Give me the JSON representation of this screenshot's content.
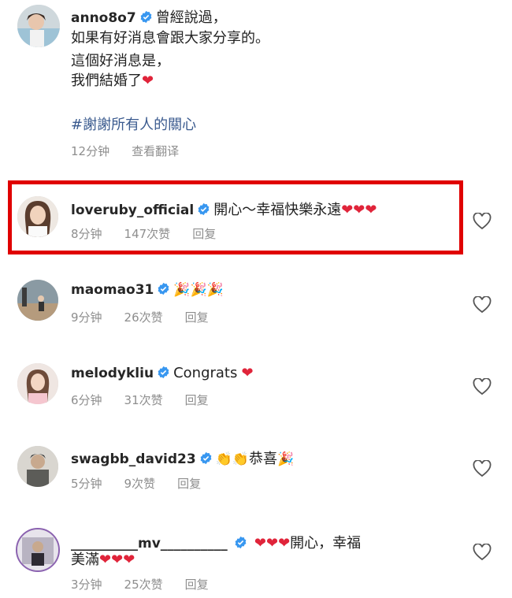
{
  "post": {
    "username": "anno8o7",
    "lines": [
      "曾經說過，",
      "如果有好消息會跟大家分享的。",
      "這個好消息是，",
      "我們結婚了"
    ],
    "hashtag": "#謝謝所有人的關心",
    "time": "12分钟",
    "translate": "查看翻译"
  },
  "comments": [
    {
      "username": "loveruby_official",
      "text": "開心～幸福快樂永遠",
      "emoji": [
        "heart",
        "heart",
        "heart"
      ],
      "time": "8分钟",
      "likes": "147次赞",
      "reply": "回复",
      "highlighted": true
    },
    {
      "username": "maomao31",
      "text": "",
      "emoji": [
        "party",
        "party",
        "party"
      ],
      "time": "9分钟",
      "likes": "26次赞",
      "reply": "回复"
    },
    {
      "username": "melodykliu",
      "text": "Congrats",
      "emoji": [
        "heart"
      ],
      "time": "6分钟",
      "likes": "31次赞",
      "reply": "回复"
    },
    {
      "username": "swagbb_david23",
      "text": "恭喜",
      "emoji": [
        "clap",
        "clap",
        "party"
      ],
      "time": "5分钟",
      "likes": "9次赞",
      "reply": "回复"
    },
    {
      "username": "__________mv__________",
      "text": "開心，幸福",
      "text2": "美滿",
      "emoji": [
        "heart",
        "heart",
        "heart"
      ],
      "time": "3分钟",
      "likes": "25次赞",
      "reply": "回复"
    }
  ],
  "colors": {
    "heart": "#e0243a",
    "verified": "#3897f0",
    "highlight": "#e00000",
    "hashtag": "#3b5b8f"
  }
}
